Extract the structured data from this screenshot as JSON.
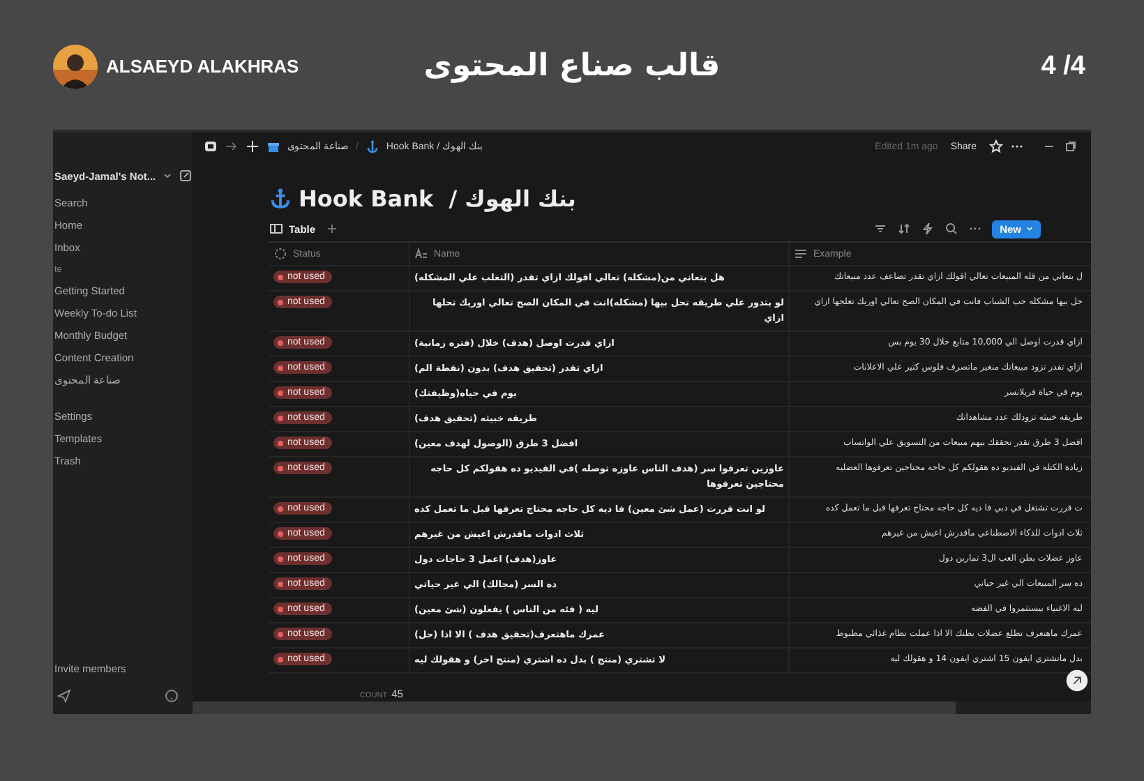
{
  "header": {
    "author": "ALSAEYD ALAKHRAS",
    "title": "قالب صناع المحتوى",
    "page": "4 /4"
  },
  "sidebar": {
    "workspace": "Saeyd-Jamal's Not...",
    "top_items": [
      "Search",
      "Home",
      "Inbox"
    ],
    "section": "te",
    "pages": [
      "Getting Started",
      "Weekly To-do List",
      "Monthly Budget",
      "Content Creation",
      "صناعة المحتوى"
    ],
    "bottom_items": [
      "Settings",
      "Templates",
      "Trash"
    ],
    "invite": "Invite members"
  },
  "topbar": {
    "parent_page": "صناعة المحتوى",
    "separator": "/",
    "current_page": "Hook Bank / بنك الهوك",
    "edited": "Edited 1m ago",
    "share": "Share"
  },
  "page_title": "Hook Bank  / بنك الهوك",
  "view_tab": {
    "label": "Table",
    "selected": true
  },
  "new_button": "New",
  "table": {
    "headers": {
      "status": "Status",
      "name": "Name",
      "example": "Example"
    },
    "rows": [
      {
        "status": "not used",
        "name": "هل بتعاني من(مشكله) تعالي اقولك ازاي تقدر (التغلب علي المشكله)",
        "example": "ل بتعاني من قله المبيعات تعالي اقولك ازاي تقدر تضاعف عدد مبيعاتك"
      },
      {
        "status": "not used",
        "name": "لو بتدور علي طريقه تحل بيها (مشكله)انت في المكان الصح تعالي اوريك تحلها ازاي",
        "example": "حل بيها مشكله حب الشباب فانت في المكان الصح تعالي اوريك تعلجها ازاي"
      },
      {
        "status": "not used",
        "name": "ازاي قدرت اوصل (هدف) خلال (فتره زمانية)",
        "example": "ازاي قدرت اوصل الي 10,000 متابع خلال 30 يوم بس"
      },
      {
        "status": "not used",
        "name": "ازاي تقدر (تحقيق هدف) بدون (نقطة الم)",
        "example": "ازاي تقدر تزود مبيعاتك منغير ماتصرف فلوس كتير علي الاعلانات"
      },
      {
        "status": "not used",
        "name": "يوم في حياه(وظيفتك)",
        "example": "يوم في حياة فريلانسر"
      },
      {
        "status": "not used",
        "name": "طريقه خبيثه (تحقيق هدف)",
        "example": "طريقه خبيثه تزودلك عدد مشاهداتك"
      },
      {
        "status": "not used",
        "name": "افضل 3 طرق (الوصول لهدف معين)",
        "example": "افضل 3 طرق تقدر تحققك بيهم مبيعات من التسويق علي الواتساب"
      },
      {
        "status": "not used",
        "name": "عاوزين تعرفوا سر (هدف الناس عاوزه توصله )في الفيديو ده هقولكم كل حاجه محتاجين تعرفوها",
        "example": "زيادة الكتله في الفيديو ده هقولكم كل حاجه محتاجين تعرفوها العضليه"
      },
      {
        "status": "not used",
        "name": "لو انت قررت (عمل شئ معين) فا ديه كل حاجه محتاج تعرفها قبل ما تعمل كده",
        "example": "ت قررت تشتغل في دبي فا ديه كل حاجه محتاج تعرفها قبل ما تعمل كده"
      },
      {
        "status": "not used",
        "name": "ثلاث ادوات ماقدرش اعيش من غيرهم",
        "example": "ثلاث ادوات للذكاء الاصطناعي ماقدرش اعيش من غيرهم"
      },
      {
        "status": "not used",
        "name": "عاوز(هدف) اعمل 3 حاجات دول",
        "example": "عاوز عضلات بطن العب ال3 تمارين دول"
      },
      {
        "status": "not used",
        "name": "ده السر (مجالك) الي غير حياتي",
        "example": "ده سر المبيعات الي غير حياتي"
      },
      {
        "status": "not used",
        "name": "ليه ( فئه من الناس ) يفعلون (شئ معين)",
        "example": "ليه الاغنياء بيستثمروا في الفضه"
      },
      {
        "status": "not used",
        "name": "عمرك ماهتعرف(تحقيق هدف ) الا اذا (حل)",
        "example": "عمرك ماهتعرف تطلع عضلات بطنك الا اذا عملت نظام غذائي مظبوط"
      },
      {
        "status": "not used",
        "name": "لا تشتري (منتج ) بدل ده اشتري (منتج اخر) و هقولك ليه",
        "example": "بدل ماتشتري ايفون 15 اشتري ايفون 14 و هقولك ليه"
      }
    ]
  },
  "count": {
    "label": "COUNT",
    "value": "45"
  }
}
